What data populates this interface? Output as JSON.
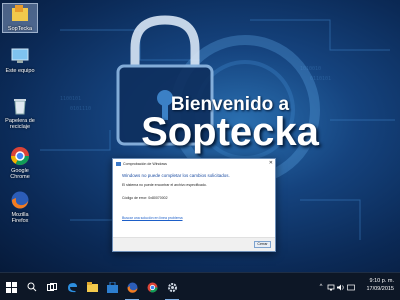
{
  "wallpaper": {
    "welcome_text": "Bienvenido a",
    "brand_text": "Soptecka"
  },
  "desktop_icons": [
    {
      "label": "SopTecka",
      "icon": "folder-app-icon"
    },
    {
      "label": "Este equipo",
      "icon": "computer-icon"
    },
    {
      "label": "Papelera de reciclaje",
      "icon": "recycle-bin-icon"
    },
    {
      "label": "Google Chrome",
      "icon": "chrome-icon"
    },
    {
      "label": "Mozilla Firefox",
      "icon": "firefox-icon"
    }
  ],
  "dialog": {
    "title": "Comprobación de Windows",
    "heading": "Windows no puede completar los cambios solicitados.",
    "message": "El sistema no puede encontrar el archivo especificado.",
    "error_code": "Código de error: 0x80070002",
    "help_link": "Buscar una solución en línea problema",
    "close_button": "Cerrar"
  },
  "taskbar": {
    "time": "9:10 p. m.",
    "date": "17/09/2015",
    "pinned": [
      "start-icon",
      "search-icon",
      "task-view-icon",
      "edge-icon",
      "file-explorer-icon",
      "store-icon",
      "firefox-icon",
      "chrome-icon",
      "settings-icon"
    ]
  },
  "colors": {
    "accent": "#1d4ea3",
    "taskbar": "#0d1726"
  }
}
